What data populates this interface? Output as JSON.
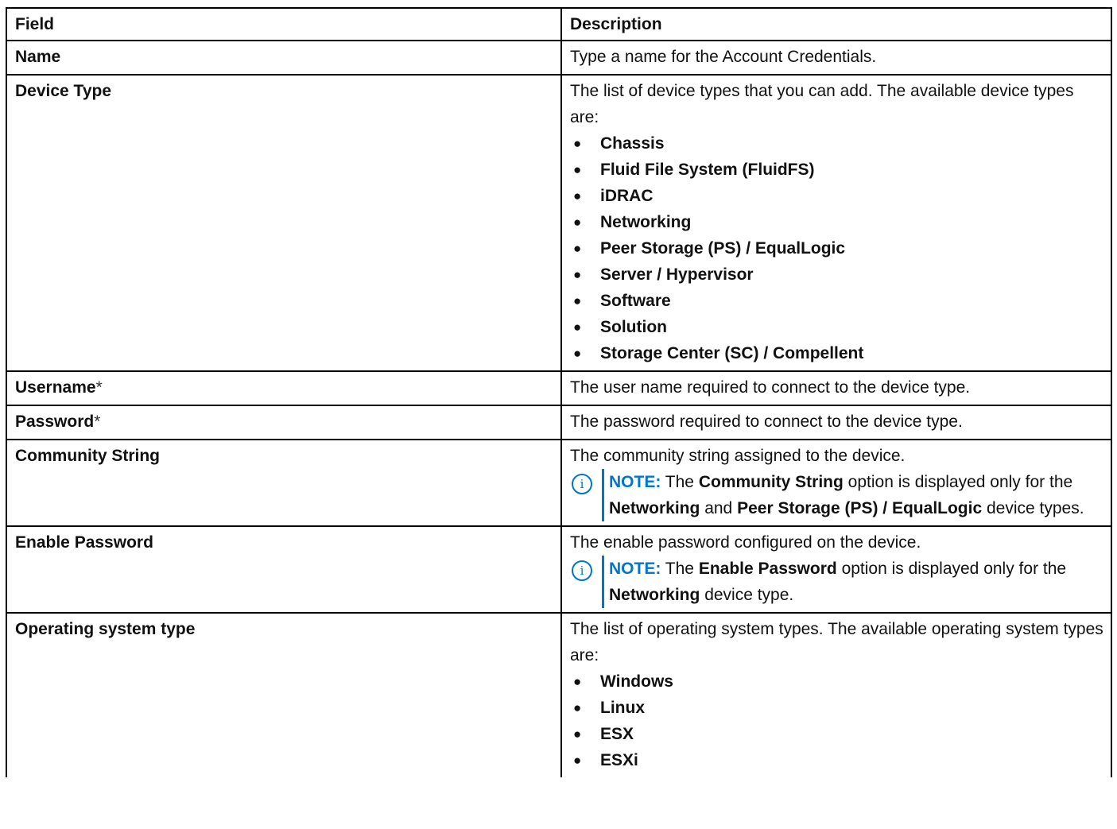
{
  "header": {
    "field": "Field",
    "description": "Description"
  },
  "rows": {
    "name": {
      "field": "Name",
      "desc": "Type a name for the Account Credentials."
    },
    "device_type": {
      "field": "Device Type",
      "desc": "The list of device types that you can add. The available device types are:",
      "options": [
        "Chassis",
        "Fluid File System (FluidFS)",
        "iDRAC",
        "Networking",
        "Peer Storage (PS) / EqualLogic",
        "Server / Hypervisor",
        "Software",
        "Solution",
        "Storage Center (SC) / Compellent"
      ]
    },
    "username": {
      "field": "Username",
      "required_mark": "*",
      "desc": "The user name required to connect to the device type."
    },
    "password": {
      "field": "Password",
      "required_mark": "*",
      "desc": "The password required to connect to the device type."
    },
    "community_string": {
      "field": "Community String",
      "desc": "The community string assigned to the device.",
      "note": {
        "label": "NOTE:",
        "t1": "The",
        "b1": "Community String",
        "t2": "option is displayed only for the",
        "b2": "Networking",
        "t3": "and",
        "b3": "Peer Storage (PS) / EqualLogic",
        "t4": "device types."
      }
    },
    "enable_password": {
      "field": "Enable Password",
      "desc": "The enable password configured on the device.",
      "note": {
        "label": "NOTE:",
        "t1": "The",
        "b1": "Enable Password",
        "t2": "option is displayed only for the",
        "b2": "Networking",
        "t3": "device type."
      }
    },
    "os_type": {
      "field": "Operating system type",
      "desc": "The list of operating system types. The available operating system types are:",
      "options": [
        "Windows",
        "Linux",
        "ESX",
        "ESXi"
      ]
    }
  },
  "icons": {
    "bullet": "●",
    "note_icon": "i"
  },
  "colors": {
    "note_accent": "#0076ce",
    "border": "#000000",
    "text": "#111111"
  }
}
